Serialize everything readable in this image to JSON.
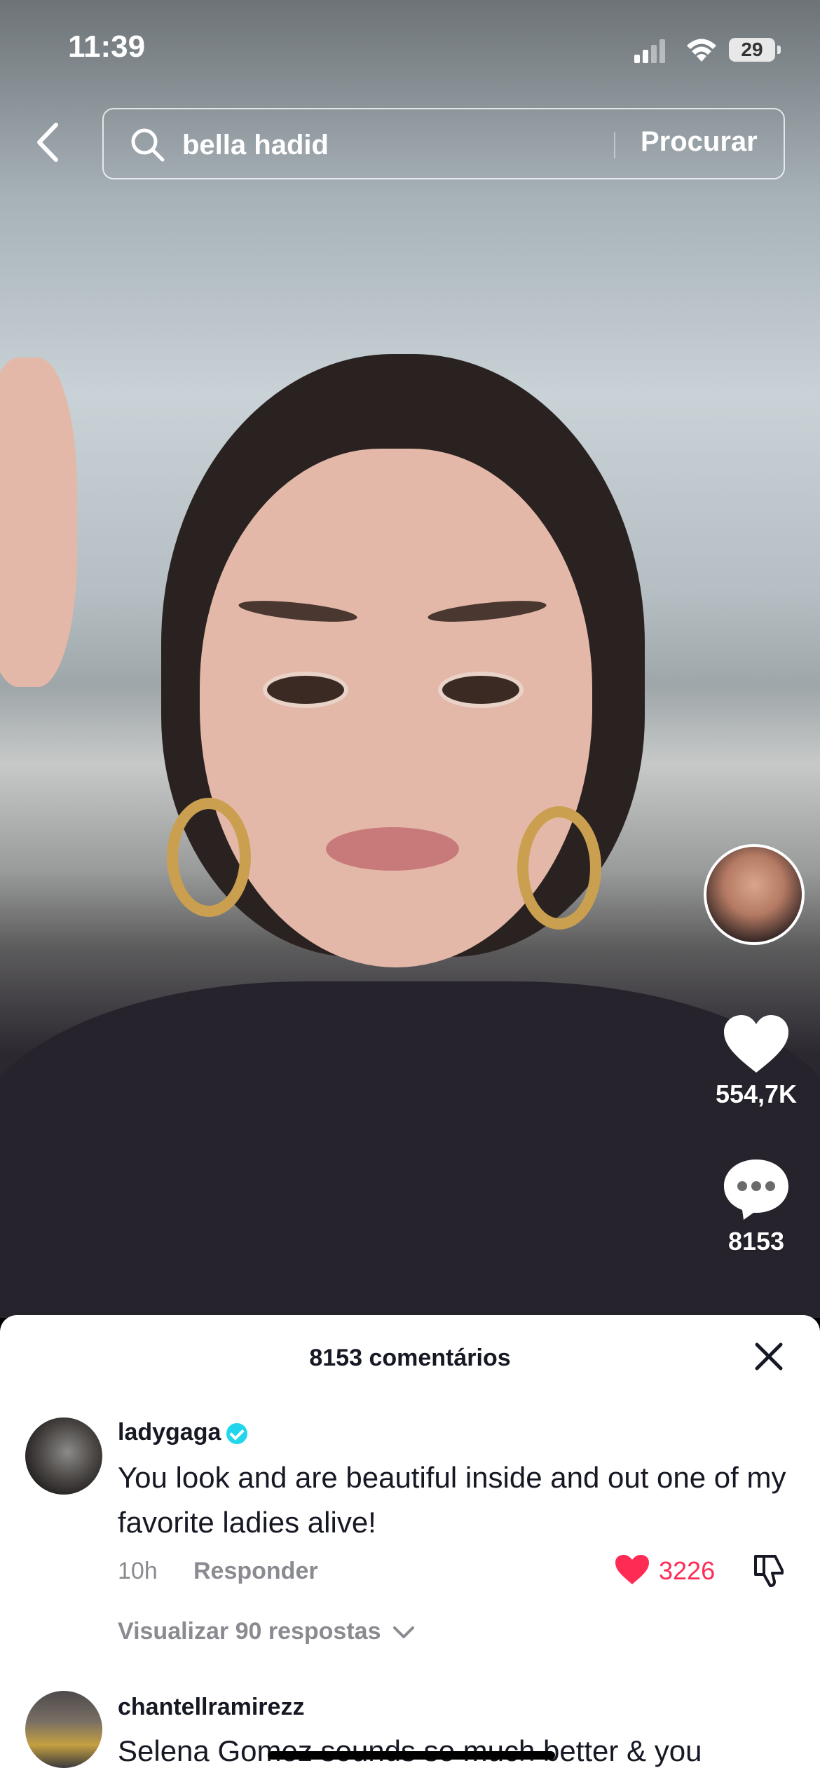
{
  "status_bar": {
    "time": "11:39",
    "battery": "29"
  },
  "search": {
    "query": "bella hadid",
    "button_label": "Procurar"
  },
  "actions": {
    "likes": "554,7K",
    "comments": "8153"
  },
  "comments_sheet": {
    "title": "8153 comentários",
    "comments": [
      {
        "username": "ladygaga",
        "verified": true,
        "text": "You look and are beautiful inside and out one of my favorite ladies alive!",
        "time": "10h",
        "reply_label": "Responder",
        "likes": "3226",
        "view_replies": "Visualizar 90 respostas"
      },
      {
        "username": "chantellramirezz",
        "text": "Selena Gomez sounds so much better & you"
      }
    ]
  },
  "colors": {
    "like_red": "#fe2c55",
    "verified_blue": "#20d5ec"
  }
}
